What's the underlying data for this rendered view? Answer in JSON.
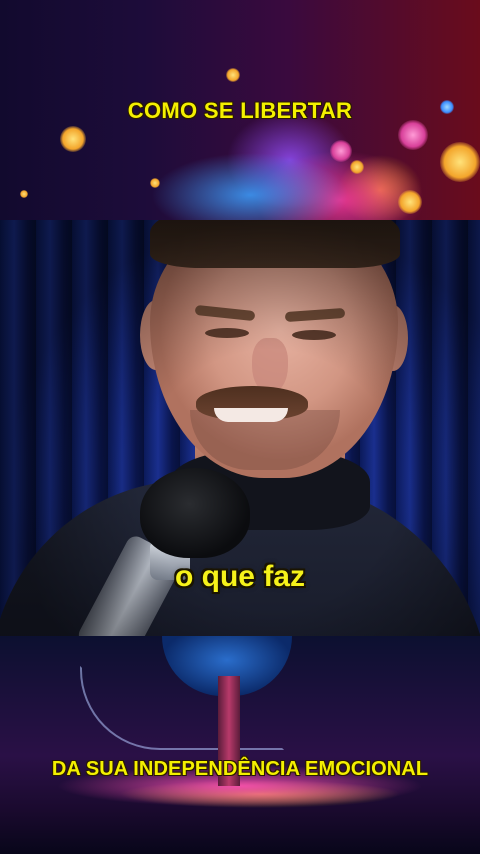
{
  "top_caption": "COMO SE LIBERTAR",
  "video_caption": "o que faz",
  "bottom_caption": "DA SUA INDEPENDÊNCIA EMOCIONAL",
  "colors": {
    "caption_yellow": "#f4f000",
    "video_backdrop_blue": "#1a2f8e",
    "banner_pink": "#ff50b4"
  }
}
